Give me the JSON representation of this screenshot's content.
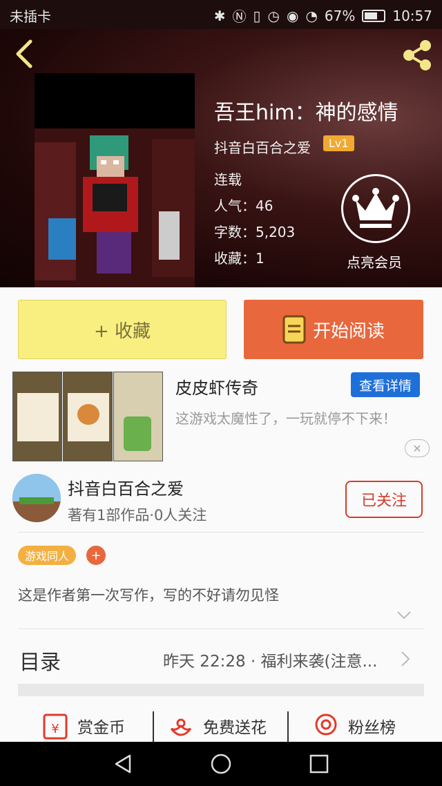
{
  "status_bar": {
    "carrier": "未插卡",
    "battery": "67%",
    "time": "10:57"
  },
  "book": {
    "title": "吾王him：神的感情",
    "author": "抖音白百合之爱",
    "level": "Lv1",
    "status": "连载",
    "popularity": "人气：46",
    "word_count": "字数：5,203",
    "favorites": "收藏：1",
    "member_label": "点亮会员"
  },
  "actions": {
    "collect_label": "+ 收藏",
    "read_label": "开始阅读"
  },
  "ad": {
    "title": "皮皮虾传奇",
    "detail_button": "查看详情",
    "description": "这游戏太魔性了，一玩就停不下来！",
    "close": "✕"
  },
  "author_card": {
    "name": "抖音白百合之爱",
    "stats": "著有1部作品·0人关注",
    "follow_label": "已关注"
  },
  "tags": {
    "items": [
      "游戏同人"
    ],
    "add": "+"
  },
  "synopsis": "这是作者第一次写作，写的不好请勿见怪",
  "toc": {
    "label": "目录",
    "latest": "昨天 22:28 · 福利来袭(注意..."
  },
  "bottom_stats": {
    "reward": "赏金币",
    "flowers": "免费送花",
    "fans": "粉丝榜"
  },
  "colors": {
    "accent_orange": "#e8673d",
    "collect_yellow": "#f8ef80",
    "follow_red": "#d43b2b",
    "ad_blue": "#1f6fd8",
    "level_badge": "#f1a931"
  }
}
